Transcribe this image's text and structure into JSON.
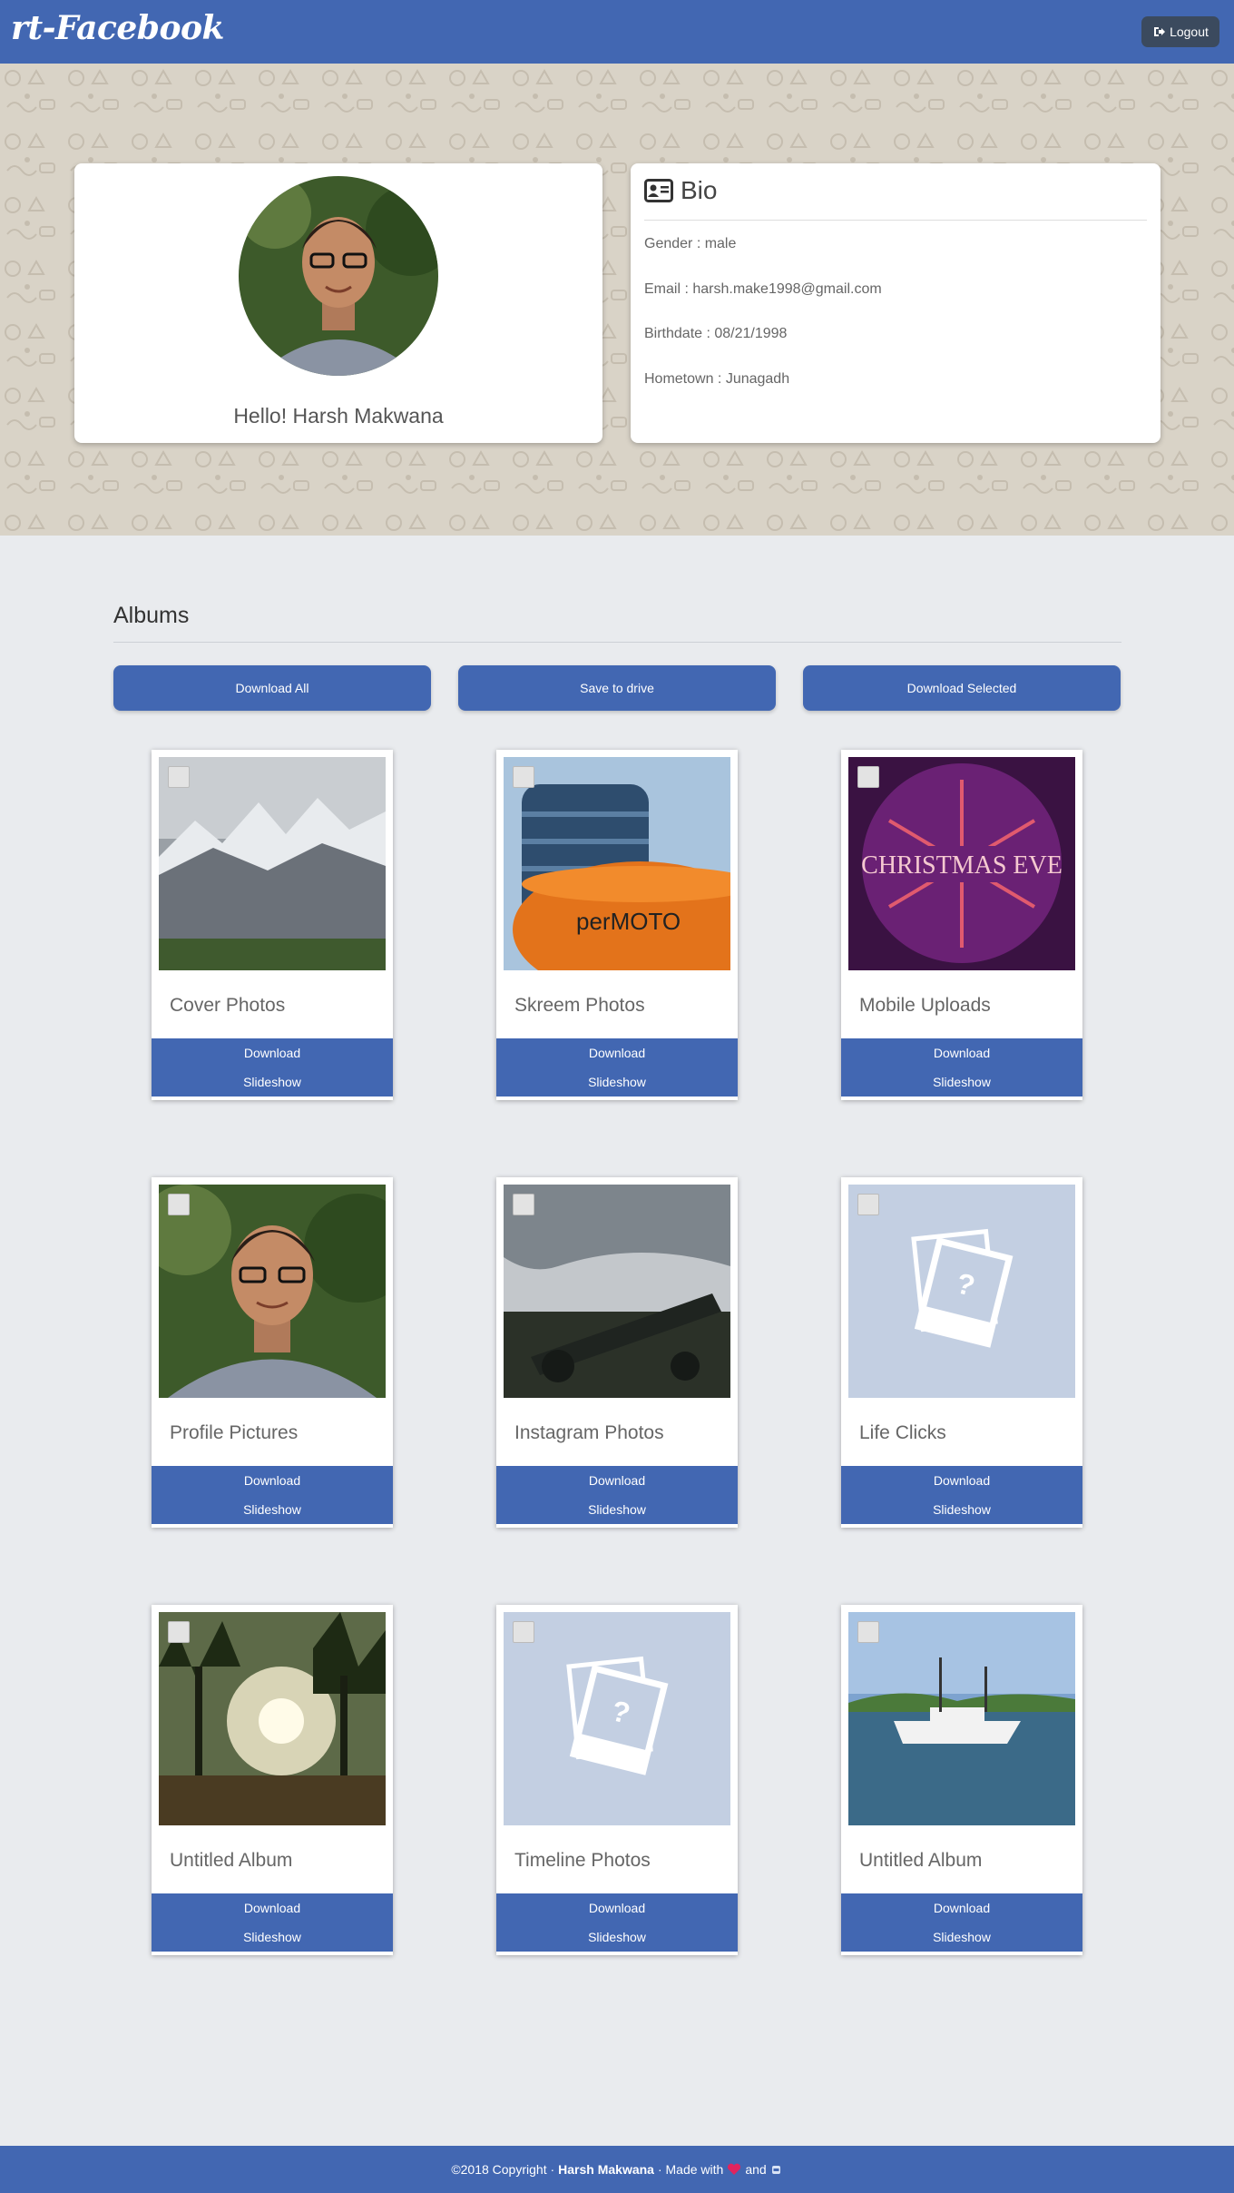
{
  "navbar": {
    "brand": "rt-Facebook",
    "logout_label": "Logout"
  },
  "profile": {
    "greeting": "Hello! Harsh Makwana"
  },
  "bio": {
    "title": "Bio",
    "gender": "Gender : male",
    "email": "Email : harsh.make1998@gmail.com",
    "birthdate": "Birthdate : 08/21/1998",
    "hometown": "Hometown : Junagadh"
  },
  "albums": {
    "title": "Albums",
    "download_all": "Download All",
    "save_to_drive": "Save to drive",
    "download_selected": "Download Selected",
    "download_label": "Download",
    "slideshow_label": "Slideshow",
    "items": [
      {
        "name": "Cover Photos",
        "thumb": "mountains"
      },
      {
        "name": "Skreem Photos",
        "thumb": "building-moto"
      },
      {
        "name": "Mobile Uploads",
        "thumb": "christmas-eve"
      },
      {
        "name": "Profile Pictures",
        "thumb": "portrait"
      },
      {
        "name": "Instagram Photos",
        "thumb": "cannon"
      },
      {
        "name": "Life Clicks",
        "thumb": "placeholder"
      },
      {
        "name": "Untitled Album",
        "thumb": "palm-sunset"
      },
      {
        "name": "Timeline Photos",
        "thumb": "placeholder"
      },
      {
        "name": "Untitled Album",
        "thumb": "boat"
      }
    ],
    "christmas_text": "CHRISTMAS EVE",
    "moto_text": "perMOTO"
  },
  "footer": {
    "prefix": "©2018 Copyright · ",
    "author": "Harsh Makwana",
    "made_with": " · Made with ",
    "and": " and "
  },
  "colors": {
    "primary": "#4267b2",
    "background": "#e9ebee",
    "hero": "#d9d3c7"
  }
}
